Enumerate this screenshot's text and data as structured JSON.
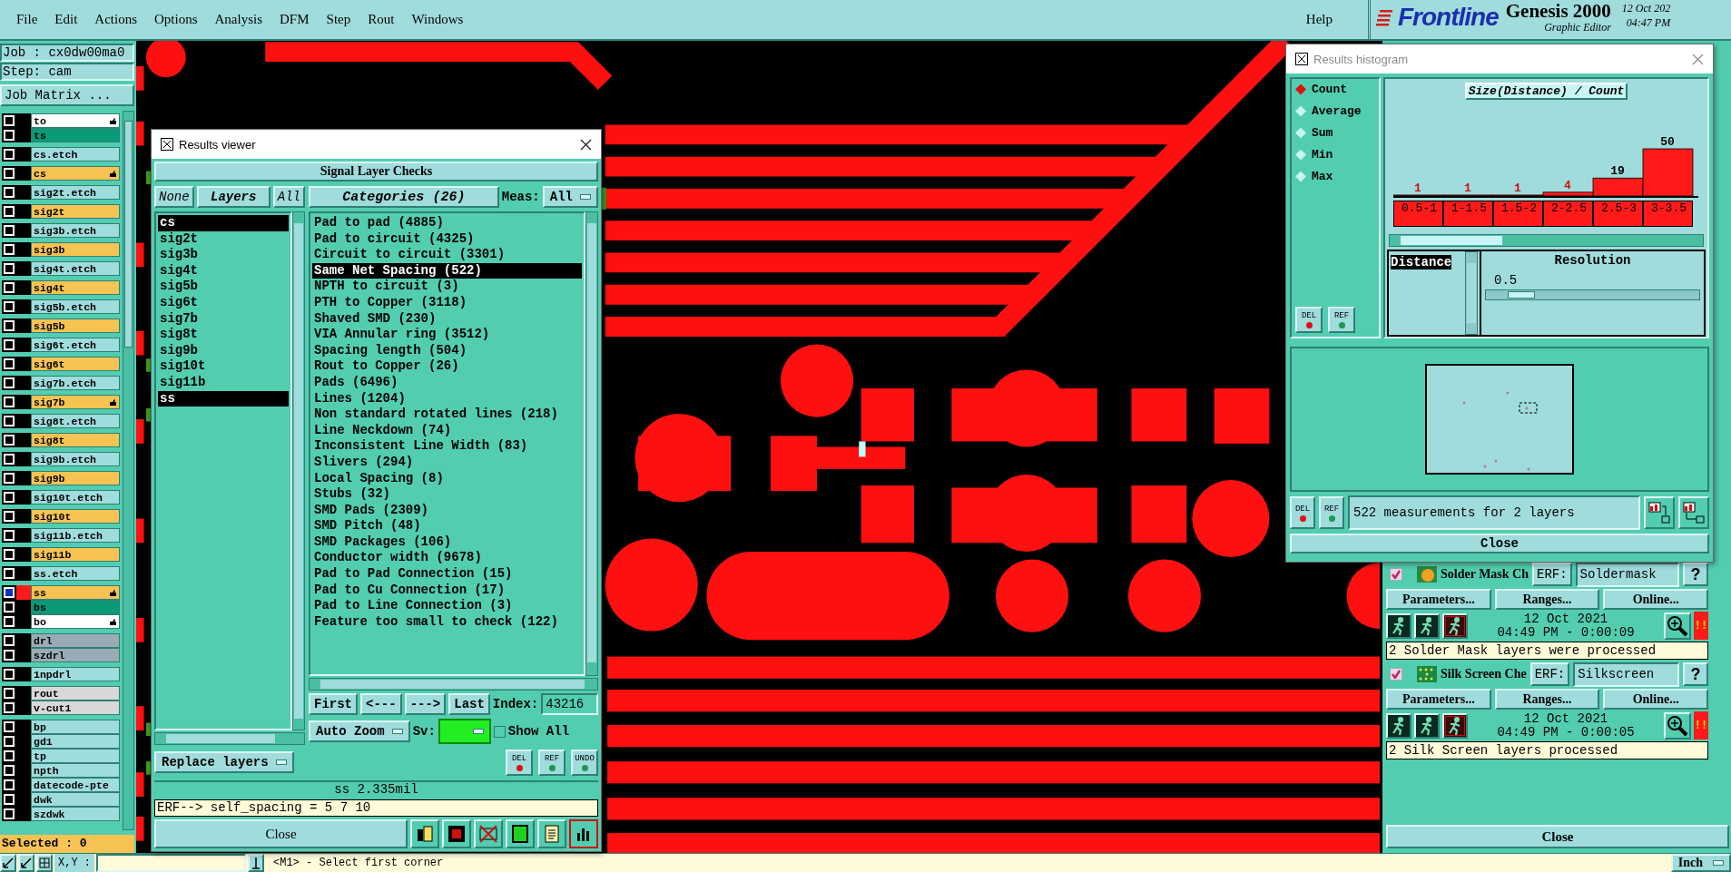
{
  "menu_bar": {
    "items": [
      "File",
      "Edit",
      "Actions",
      "Options",
      "Analysis",
      "DFM",
      "Step",
      "Rout",
      "Windows"
    ],
    "help": "Help",
    "logo": {
      "brand": "Frontline",
      "product": "Genesis 2000",
      "subtitle": "Graphic Editor",
      "date": "12 Oct 202",
      "time": "04:47 PM"
    }
  },
  "job_panel": {
    "job": "Job : cx0dw00ma0",
    "step": "Step: cam",
    "matrix_button": "Job Matrix ...",
    "selected": "Selected : 0",
    "layer_groups": [
      [
        {
          "name": "to",
          "color": "#ffffff",
          "marked": true,
          "active": false
        },
        {
          "name": "ts",
          "color": "#0a9a78",
          "marked": false,
          "active": false
        }
      ],
      [
        {
          "name": "cs.etch",
          "color": "#9fdcdc",
          "marked": false,
          "active": false
        }
      ],
      [
        {
          "name": "cs",
          "color": "#f7c353",
          "marked": true,
          "active": false
        }
      ],
      [
        {
          "name": "sig2t.etch",
          "color": "#9fdcdc",
          "marked": false,
          "active": false
        }
      ],
      [
        {
          "name": "sig2t",
          "color": "#f7c353",
          "marked": false,
          "active": false
        }
      ],
      [
        {
          "name": "sig3b.etch",
          "color": "#9fdcdc",
          "marked": false,
          "active": false
        }
      ],
      [
        {
          "name": "sig3b",
          "color": "#f7c353",
          "marked": false,
          "active": false
        }
      ],
      [
        {
          "name": "sig4t.etch",
          "color": "#9fdcdc",
          "marked": false,
          "active": false
        }
      ],
      [
        {
          "name": "sig4t",
          "color": "#f7c353",
          "marked": false,
          "active": false
        }
      ],
      [
        {
          "name": "sig5b.etch",
          "color": "#9fdcdc",
          "marked": false,
          "active": false
        }
      ],
      [
        {
          "name": "sig5b",
          "color": "#f7c353",
          "marked": false,
          "active": false
        }
      ],
      [
        {
          "name": "sig6t.etch",
          "color": "#9fdcdc",
          "marked": false,
          "active": false
        }
      ],
      [
        {
          "name": "sig6t",
          "color": "#f7c353",
          "marked": false,
          "active": false
        }
      ],
      [
        {
          "name": "sig7b.etch",
          "color": "#9fdcdc",
          "marked": false,
          "active": false
        }
      ],
      [
        {
          "name": "sig7b",
          "color": "#f7c353",
          "marked": true,
          "active": false
        }
      ],
      [
        {
          "name": "sig8t.etch",
          "color": "#9fdcdc",
          "marked": false,
          "active": false
        }
      ],
      [
        {
          "name": "sig8t",
          "color": "#f7c353",
          "marked": false,
          "active": false
        }
      ],
      [
        {
          "name": "sig9b.etch",
          "color": "#9fdcdc",
          "marked": false,
          "active": false
        }
      ],
      [
        {
          "name": "sig9b",
          "color": "#f7c353",
          "marked": false,
          "active": false
        }
      ],
      [
        {
          "name": "sig10t.etch",
          "color": "#9fdcdc",
          "marked": false,
          "active": false
        }
      ],
      [
        {
          "name": "sig10t",
          "color": "#f7c353",
          "marked": false,
          "active": false
        }
      ],
      [
        {
          "name": "sig11b.etch",
          "color": "#9fdcdc",
          "marked": false,
          "active": false
        }
      ],
      [
        {
          "name": "sig11b",
          "color": "#f7c353",
          "marked": false,
          "active": false
        }
      ],
      [
        {
          "name": "ss.etch",
          "color": "#9fdcdc",
          "marked": false,
          "active": false
        }
      ],
      [
        {
          "name": "ss",
          "color": "#f7c353",
          "marked": true,
          "active": true
        },
        {
          "name": "bs",
          "color": "#0a9a78",
          "marked": false,
          "active": false
        },
        {
          "name": "bo",
          "color": "#ffffff",
          "marked": true,
          "active": false
        }
      ],
      [
        {
          "name": "drl",
          "color": "#9aabb6",
          "marked": false,
          "active": false
        },
        {
          "name": "szdrl",
          "color": "#9aabb6",
          "marked": false,
          "active": false
        }
      ],
      [
        {
          "name": "1npdrl",
          "color": "#9fdcdc",
          "marked": false,
          "active": false
        }
      ],
      [
        {
          "name": "rout",
          "color": "#d8d8d8",
          "marked": false,
          "active": false
        },
        {
          "name": "v-cut1",
          "color": "#d8d8d8",
          "marked": false,
          "active": false
        }
      ],
      [
        {
          "name": "bp",
          "color": "#9fdcdc",
          "marked": false,
          "active": false
        },
        {
          "name": "gd1",
          "color": "#9fdcdc",
          "marked": false,
          "active": false
        },
        {
          "name": "tp",
          "color": "#9fdcdc",
          "marked": false,
          "active": false
        },
        {
          "name": "npth",
          "color": "#9fdcdc",
          "marked": false,
          "active": false
        },
        {
          "name": "datecode-pte",
          "color": "#9fdcdc",
          "marked": false,
          "active": false
        },
        {
          "name": "dwk",
          "color": "#9fdcdc",
          "marked": false,
          "active": false
        },
        {
          "name": "szdwk",
          "color": "#9fdcdc",
          "marked": false,
          "active": false
        }
      ]
    ]
  },
  "results_viewer": {
    "title": "Results viewer",
    "section": "Signal Layer Checks",
    "none_button": "None",
    "layers_button": "Layers",
    "all_button": "All",
    "categories_button": "Categories (26)",
    "meas_label": "Meas:",
    "meas_value": "All",
    "layers": [
      {
        "name": "cs",
        "selected": true
      },
      {
        "name": "sig2t",
        "selected": false
      },
      {
        "name": "sig3b",
        "selected": false
      },
      {
        "name": "sig4t",
        "selected": false
      },
      {
        "name": "sig5b",
        "selected": false
      },
      {
        "name": "sig6t",
        "selected": false
      },
      {
        "name": "sig7b",
        "selected": false
      },
      {
        "name": "sig8t",
        "selected": false
      },
      {
        "name": "sig9b",
        "selected": false
      },
      {
        "name": "sig10t",
        "selected": false
      },
      {
        "name": "sig11b",
        "selected": false
      },
      {
        "name": "ss",
        "selected": true
      }
    ],
    "categories": [
      {
        "label": "Pad to pad (4885)",
        "selected": false
      },
      {
        "label": "Pad to circuit (4325)",
        "selected": false
      },
      {
        "label": "Circuit to circuit (3301)",
        "selected": false
      },
      {
        "label": "Same Net Spacing (522)",
        "selected": true
      },
      {
        "label": "NPTH to circuit (3)",
        "selected": false
      },
      {
        "label": "PTH to Copper (3118)",
        "selected": false
      },
      {
        "label": "Shaved SMD (230)",
        "selected": false
      },
      {
        "label": "VIA Annular ring (3512)",
        "selected": false
      },
      {
        "label": "Spacing length (504)",
        "selected": false
      },
      {
        "label": "Rout to Copper (26)",
        "selected": false
      },
      {
        "label": "Pads (6496)",
        "selected": false
      },
      {
        "label": "Lines (1204)",
        "selected": false
      },
      {
        "label": "Non standard rotated lines (218)",
        "selected": false
      },
      {
        "label": "Line Neckdown (74)",
        "selected": false
      },
      {
        "label": "Inconsistent Line Width (83)",
        "selected": false
      },
      {
        "label": "Slivers (294)",
        "selected": false
      },
      {
        "label": "Local Spacing (8)",
        "selected": false
      },
      {
        "label": "Stubs (32)",
        "selected": false
      },
      {
        "label": "SMD Pads (2309)",
        "selected": false
      },
      {
        "label": "SMD Pitch (48)",
        "selected": false
      },
      {
        "label": "SMD Packages (106)",
        "selected": false
      },
      {
        "label": "Conductor width (9678)",
        "selected": false
      },
      {
        "label": "Pad to Pad Connection (15)",
        "selected": false
      },
      {
        "label": "Pad to Cu Connection (17)",
        "selected": false
      },
      {
        "label": "Pad to Line Connection (3)",
        "selected": false
      },
      {
        "label": "Feature too small to check (122)",
        "selected": false
      }
    ],
    "nav_buttons": [
      "First",
      "<---",
      "--->",
      "Last"
    ],
    "index_label": "Index:",
    "index_value": "43216",
    "zoom_mode": "Auto Zoom",
    "sv_label": "Sv:",
    "show_all": {
      "label": "Show All",
      "checked": false
    },
    "replace_mode": "Replace layers",
    "tool_buttons": [
      "DEL",
      "REF",
      "UNDO"
    ],
    "measurement": "ss 2.335mil",
    "erf": "ERF--> self_spacing = 5 7 10",
    "close": "Close"
  },
  "histogram": {
    "title": "Results histogram",
    "modes": [
      {
        "label": "Count",
        "selected": true
      },
      {
        "label": "Average",
        "selected": false
      },
      {
        "label": "Sum",
        "selected": false
      },
      {
        "label": "Min",
        "selected": false
      },
      {
        "label": "Max",
        "selected": false
      }
    ],
    "chart_data": {
      "type": "bar",
      "title": "Size(Distance) / Count",
      "categories": [
        "0.5-1",
        "1-1.5",
        "1.5-2",
        "2-2.5",
        "2.5-3",
        "3-3.5"
      ],
      "values": [
        1,
        1,
        1,
        4,
        19,
        50
      ],
      "data_labels": true
    },
    "attributes": [
      {
        "label": "Distance",
        "selected": true
      }
    ],
    "resolution_label": "Resolution",
    "resolution_value": "0.5",
    "resolution_slider": {
      "level": 0.1
    },
    "tool_buttons": [
      "DEL",
      "REF"
    ],
    "summary_buttons": [
      "DEL",
      "REF"
    ],
    "summary": "522 measurements for 2 layers",
    "close": "Close"
  },
  "right_panel": {
    "checks": [
      {
        "kind": "soldermask",
        "name": "Solder Mask Ch",
        "checked": true,
        "erf_label": "ERF:",
        "erf_value": "Soldermask",
        "help": "?",
        "buttons": [
          "Parameters...",
          "Ranges...",
          "Online..."
        ],
        "date": "12 Oct 2021",
        "time": "04:49 PM - 0:00:09",
        "status": "!!",
        "message": "2 Solder Mask layers were processed"
      },
      {
        "kind": "silkscreen",
        "name": "Silk Screen Che",
        "checked": true,
        "erf_label": "ERF:",
        "erf_value": "Silkscreen",
        "help": "?",
        "buttons": [
          "Parameters...",
          "Ranges...",
          "Online..."
        ],
        "date": "12 Oct 2021",
        "time": "04:49 PM - 0:00:05",
        "status": "!!",
        "message": "2 Silk Screen layers processed"
      }
    ],
    "close": "Close"
  },
  "status_bar": {
    "xy_label": "X,Y :",
    "prompt": "<M1> - Select first corner",
    "units": "Inch"
  }
}
